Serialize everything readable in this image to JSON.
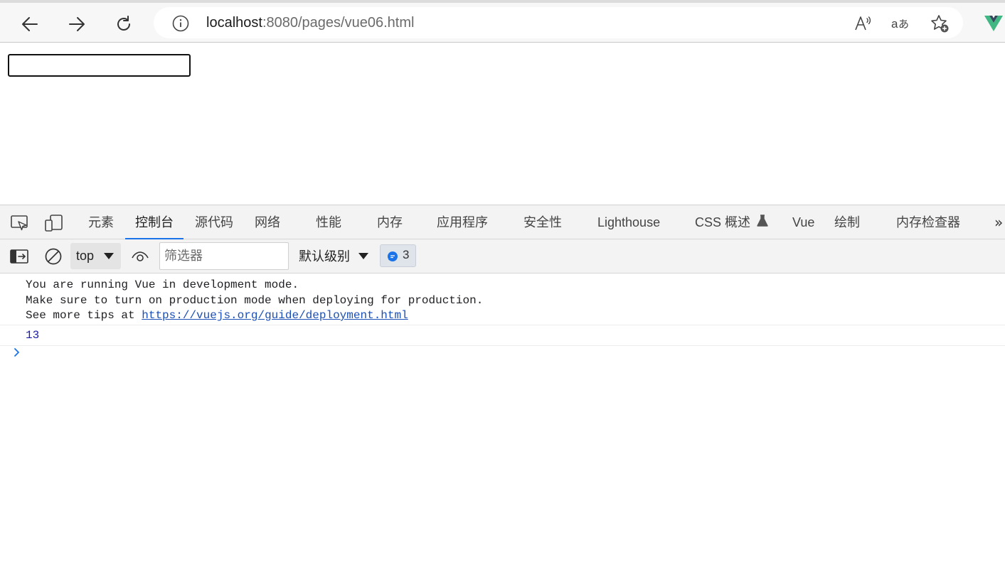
{
  "browser": {
    "url_host": "localhost",
    "url_path": ":8080/pages/vue06.html"
  },
  "page": {
    "text_input_value": ""
  },
  "devtools": {
    "tabs": [
      {
        "label": "元素"
      },
      {
        "label": "控制台"
      },
      {
        "label": "源代码"
      },
      {
        "label": "网络"
      },
      {
        "label": "性能"
      },
      {
        "label": "内存"
      },
      {
        "label": "应用程序"
      },
      {
        "label": "安全性"
      },
      {
        "label": "Lighthouse"
      },
      {
        "label": "CSS 概述"
      },
      {
        "label": "Vue"
      },
      {
        "label": "绘制"
      },
      {
        "label": "内存检查器"
      }
    ],
    "active_tab": "控制台",
    "toolbar": {
      "context": "top",
      "filter_placeholder": "筛选器",
      "levels_label": "默认级别",
      "message_count": "3"
    },
    "console": {
      "line1": "You are running Vue in development mode.",
      "line2": "Make sure to turn on production mode when deploying for production.",
      "line3_prefix": "See more tips at ",
      "link": "https://vuejs.org/guide/deployment.html",
      "number_output": "13"
    }
  },
  "colors": {
    "accent": "#1a73e8",
    "vue_green": "#41b883",
    "vue_dark": "#35495e"
  }
}
